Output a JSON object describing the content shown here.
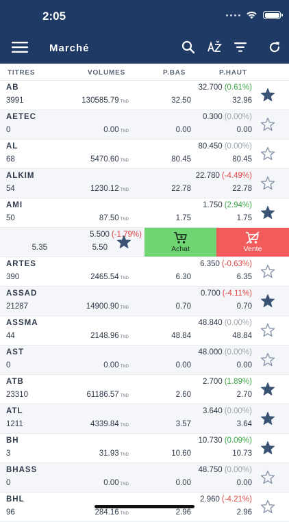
{
  "status": {
    "time": "2:05"
  },
  "header": {
    "title": "Marché"
  },
  "columns": {
    "titres": "TITRES",
    "volumes": "VOLUMES",
    "pbas": "P.BAS",
    "phaut": "P.HAUT"
  },
  "currency": "TND",
  "colors": {
    "header_bg": "#1f3a64",
    "positive": "#3aa845",
    "negative": "#e04646",
    "buy": "#6fd572",
    "sell": "#f25b5b",
    "star_filled": "#3b5375"
  },
  "rows": [
    {
      "symbol": "AB",
      "count": "3991",
      "volume": "130585.79",
      "last": "32.700",
      "change": "(0.61%)",
      "dir": "pos",
      "pbas": "32.50",
      "phaut": "32.96",
      "fav": true
    },
    {
      "symbol": "AETEC",
      "count": "0",
      "volume": "0.00",
      "last": "0.300",
      "change": "(0.00%)",
      "dir": "zero",
      "pbas": "0.00",
      "phaut": "0.00",
      "fav": false
    },
    {
      "symbol": "AL",
      "count": "68",
      "volume": "5470.60",
      "last": "80.450",
      "change": "(0.00%)",
      "dir": "zero",
      "pbas": "80.45",
      "phaut": "80.45",
      "fav": false
    },
    {
      "symbol": "ALKIM",
      "count": "54",
      "volume": "1230.12",
      "last": "22.780",
      "change": "(-4.49%)",
      "dir": "neg",
      "pbas": "22.78",
      "phaut": "22.78",
      "fav": false
    },
    {
      "symbol": "AMI",
      "count": "50",
      "volume": "87.50",
      "last": "1.750",
      "change": "(2.94%)",
      "dir": "pos",
      "pbas": "1.75",
      "phaut": "1.75",
      "fav": true
    },
    {
      "swiped": true,
      "last": "5.500",
      "change": "(-1.79%)",
      "dir": "neg",
      "pbas": "5.35",
      "phaut": "5.50",
      "fav": true,
      "buy_label": "Achat",
      "sell_label": "Vente"
    },
    {
      "symbol": "ARTES",
      "count": "390",
      "volume": "2465.54",
      "last": "6.350",
      "change": "(-0.63%)",
      "dir": "neg",
      "pbas": "6.30",
      "phaut": "6.35",
      "fav": false
    },
    {
      "symbol": "ASSAD",
      "count": "21287",
      "volume": "14900.90",
      "last": "0.700",
      "change": "(-4.11%)",
      "dir": "neg",
      "pbas": "0.70",
      "phaut": "0.70",
      "fav": true
    },
    {
      "symbol": "ASSMA",
      "count": "44",
      "volume": "2148.96",
      "last": "48.840",
      "change": "(0.00%)",
      "dir": "zero",
      "pbas": "48.84",
      "phaut": "48.84",
      "fav": false
    },
    {
      "symbol": "AST",
      "count": "0",
      "volume": "0.00",
      "last": "48.000",
      "change": "(0.00%)",
      "dir": "zero",
      "pbas": "0.00",
      "phaut": "0.00",
      "fav": false
    },
    {
      "symbol": "ATB",
      "count": "23310",
      "volume": "61186.57",
      "last": "2.700",
      "change": "(1.89%)",
      "dir": "pos",
      "pbas": "2.60",
      "phaut": "2.70",
      "fav": true
    },
    {
      "symbol": "ATL",
      "count": "1211",
      "volume": "4339.84",
      "last": "3.640",
      "change": "(0.00%)",
      "dir": "zero",
      "pbas": "3.57",
      "phaut": "3.64",
      "fav": true
    },
    {
      "symbol": "BH",
      "count": "3",
      "volume": "31.93",
      "last": "10.730",
      "change": "(0.09%)",
      "dir": "pos",
      "pbas": "10.60",
      "phaut": "10.73",
      "fav": true
    },
    {
      "symbol": "BHASS",
      "count": "0",
      "volume": "0.00",
      "last": "48.750",
      "change": "(0.00%)",
      "dir": "zero",
      "pbas": "0.00",
      "phaut": "0.00",
      "fav": false
    },
    {
      "symbol": "BHL",
      "count": "96",
      "volume": "284.16",
      "last": "2.960",
      "change": "(-4.21%)",
      "dir": "neg",
      "pbas": "2.96",
      "phaut": "2.96",
      "fav": false
    }
  ]
}
